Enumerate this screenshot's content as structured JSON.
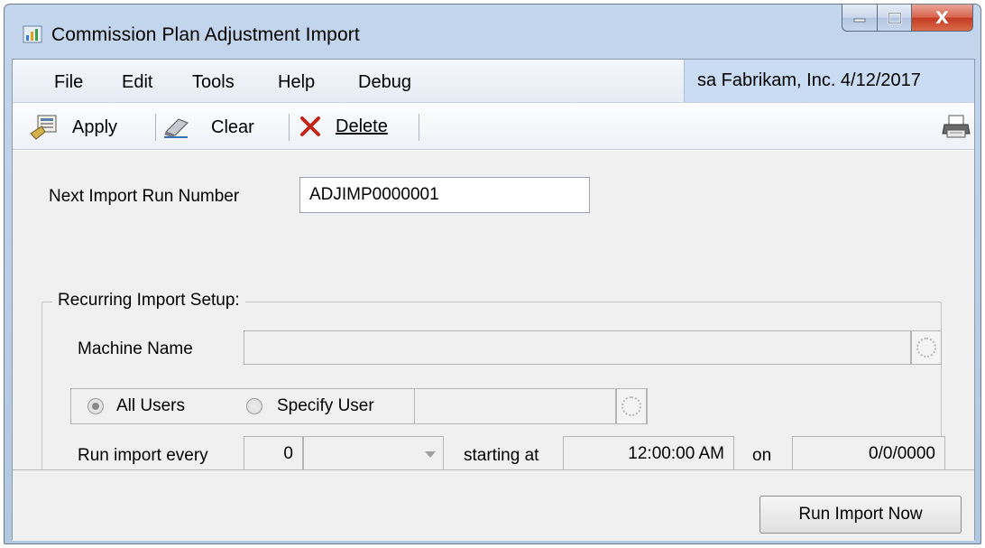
{
  "window": {
    "title": "Commission Plan Adjustment Import",
    "close_glyph": "X"
  },
  "menu": {
    "items": [
      "File",
      "Edit",
      "Tools",
      "Help",
      "Debug"
    ],
    "company_info": "sa  Fabrikam, Inc.  4/12/2017"
  },
  "toolbar": {
    "apply_label": "Apply",
    "clear_label": "Clear",
    "delete_label": "Delete"
  },
  "form": {
    "next_run_label": "Next Import Run Number",
    "next_run_value": "ADJIMP0000001",
    "group_title": "Recurring Import Setup:",
    "machine_name_label": "Machine Name",
    "machine_name_value": "",
    "all_users_label": "All Users",
    "specify_user_label": "Specify User",
    "selected_user_option": "All Users",
    "specify_user_value": "",
    "run_every_label": "Run import every",
    "run_every_value": "0",
    "interval_unit": "",
    "starting_at_label": "starting at",
    "starting_at_value": "12:00:00 AM",
    "on_label": "on",
    "on_value": "0/0/0000"
  },
  "footer": {
    "run_now_label": "Run Import Now"
  },
  "icons": {
    "app": "chart-icon",
    "apply": "apply-icon",
    "clear": "eraser-icon",
    "delete": "delete-x-icon",
    "print": "printer-icon"
  },
  "colors": {
    "title_bar": "#bcd0e8",
    "company_bar": "#c9dcf3",
    "close_button": "#c43a22",
    "delete_x": "#c2241a"
  }
}
